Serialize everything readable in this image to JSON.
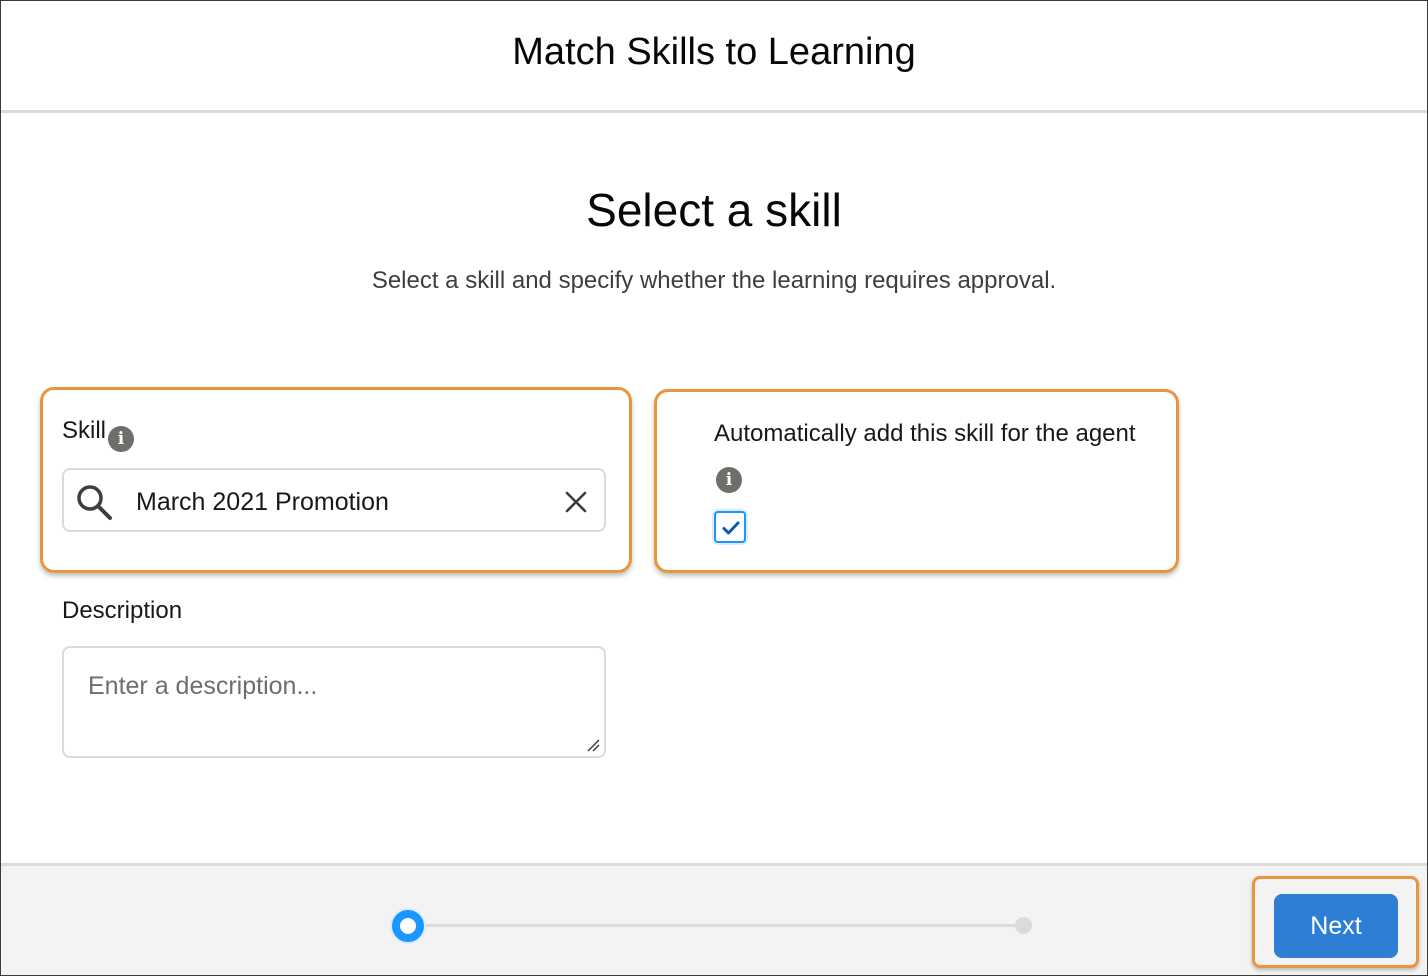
{
  "header": {
    "title": "Match Skills to Learning"
  },
  "step": {
    "title": "Select a skill",
    "subtitle": "Select a skill and specify whether the learning requires approval."
  },
  "skill_field": {
    "label": "Skill",
    "info_glyph": "i",
    "value": "March 2021 Promotion",
    "icon": "search-icon",
    "clear_icon": "close-icon"
  },
  "auto_add": {
    "label": "Automatically add this skill for the agent",
    "info_glyph": "i",
    "checked": true
  },
  "description_field": {
    "label": "Description",
    "value": "",
    "placeholder": "Enter a description..."
  },
  "progress": {
    "current_step": 1,
    "total_steps": 2
  },
  "footer": {
    "next_label": "Next"
  },
  "colors": {
    "accent": "#1b96ff",
    "button": "#2e7ed6",
    "highlight": "#e8963a"
  }
}
